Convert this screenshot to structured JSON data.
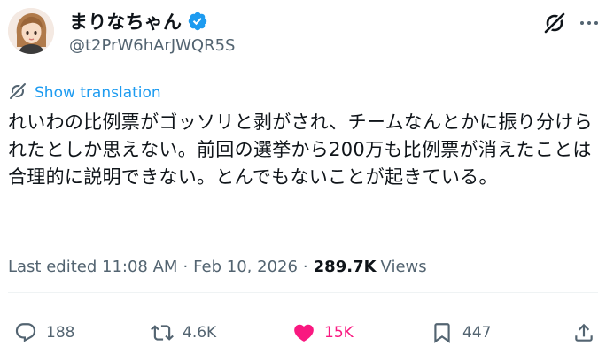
{
  "user": {
    "display_name": "まりなちゃん",
    "handle": "@t2PrW6hArJWQR5S",
    "verified": true
  },
  "translate": {
    "label": "Show translation"
  },
  "tweet": {
    "text": "れいわの比例票がゴッソリと剥がされ、チームなんとかに振り分けられたとしか思えない。前回の選挙から200万も比例票が消えたことは合理的に説明できない。とんでもないことが起きている。"
  },
  "meta": {
    "edited": "Last edited 11:08 AM",
    "separator": "·",
    "date": "Feb 10, 2026",
    "views_count": "289.7K",
    "views_label": "Views"
  },
  "actions": {
    "reply_count": "188",
    "retweet_count": "4.6K",
    "like_count": "15K",
    "bookmark_count": "447"
  },
  "colors": {
    "accent": "#1d9bf0",
    "like": "#f91880",
    "muted": "#536471",
    "text": "#0f1419"
  },
  "icons": {
    "verified": "verified-badge-icon",
    "grok": "grok-icon",
    "more": "more-icon",
    "translate": "translate-icon",
    "reply": "reply-icon",
    "retweet": "retweet-icon",
    "like": "heart-icon",
    "bookmark": "bookmark-icon",
    "share": "share-icon"
  }
}
